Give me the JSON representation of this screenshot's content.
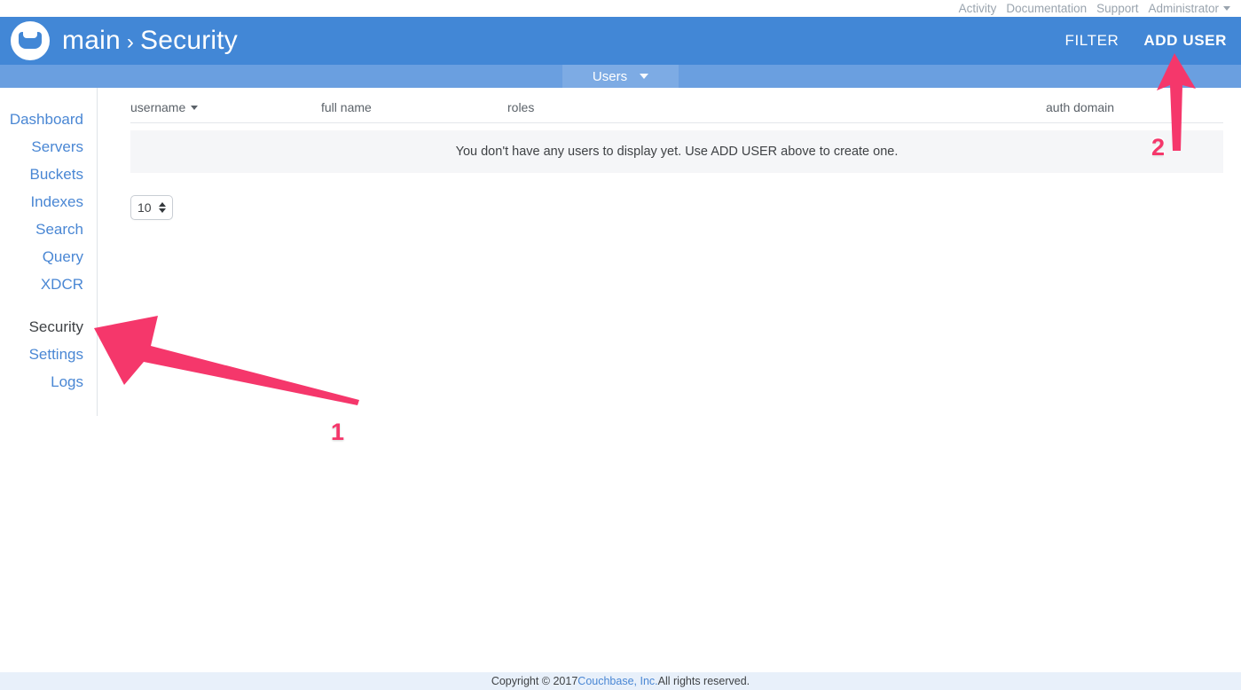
{
  "topbar": {
    "links": [
      {
        "label": "Activity"
      },
      {
        "label": "Documentation"
      },
      {
        "label": "Support"
      },
      {
        "label": "Administrator"
      }
    ]
  },
  "header": {
    "cluster": "main",
    "separator": "›",
    "section": "Security",
    "logo_icon": "couchbase-logo-icon",
    "actions": [
      {
        "label": "FILTER",
        "name": "filter-button"
      },
      {
        "label": "ADD USER",
        "name": "add-user-button"
      }
    ]
  },
  "tabs": [
    {
      "label": "Users",
      "icon": "chevron-down-icon",
      "active": true
    }
  ],
  "sidebar": {
    "items": [
      {
        "label": "Dashboard",
        "active": false
      },
      {
        "label": "Servers",
        "active": false
      },
      {
        "label": "Buckets",
        "active": false
      },
      {
        "label": "Indexes",
        "active": false
      },
      {
        "label": "Search",
        "active": false
      },
      {
        "label": "Query",
        "active": false
      },
      {
        "label": "XDCR",
        "active": false
      },
      {
        "label": "Security",
        "active": true
      },
      {
        "label": "Settings",
        "active": false
      },
      {
        "label": "Logs",
        "active": false
      }
    ]
  },
  "table": {
    "columns": [
      {
        "label": "username",
        "sortable": true,
        "sort_icon": "caret-down-icon"
      },
      {
        "label": "full name",
        "sortable": false
      },
      {
        "label": "roles",
        "sortable": false
      },
      {
        "label": "auth domain",
        "sortable": false
      }
    ],
    "rows": [],
    "empty_message": "You don't have any users to display yet. Use ADD USER above to create one."
  },
  "pagination": {
    "page_size": "10",
    "stepper_icon": "up-down-stepper-icon"
  },
  "footer": {
    "prefix": "Copyright © 2017 ",
    "link": "Couchbase, Inc.",
    "suffix": " All rights reserved."
  },
  "annotations": [
    {
      "label": "1",
      "points_to": "Security",
      "color": "#f5376b"
    },
    {
      "label": "2",
      "points_to": "ADD USER",
      "color": "#f5376b"
    }
  ],
  "colors": {
    "header_blue": "#4287d6",
    "tabbar_blue": "#6a9fe0",
    "tab_active_blue": "#7dabe4",
    "link_blue": "#4a87d4",
    "annotation_pink": "#f5376b",
    "empty_row_bg": "#f5f6f8",
    "footer_bg": "#e8f0fa"
  }
}
